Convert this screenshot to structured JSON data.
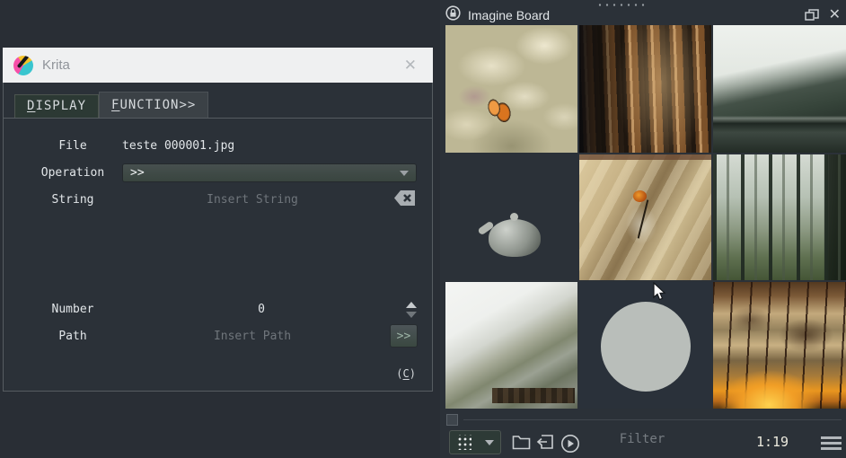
{
  "colors": {
    "window_bg": "#292e35",
    "panel_bg": "#2b3138",
    "titlebar_light": "#eff0f1",
    "accent_green_button": "#3a4841",
    "text_light": "#e2e6e9",
    "text_placeholder": "#6f757b"
  },
  "krita_dialog": {
    "title": "Krita",
    "close_glyph": "✕",
    "tabs": {
      "display": {
        "accel": "D",
        "rest": "ISPLAY"
      },
      "function": {
        "accel": "F",
        "rest": "UNCTION>>"
      }
    },
    "fields": {
      "file": {
        "label": "File",
        "value": "teste 000001.jpg"
      },
      "operation": {
        "label": "Operation",
        "value": ">>"
      },
      "string": {
        "label": "String",
        "placeholder": "Insert String"
      },
      "number": {
        "label": "Number",
        "value": "0"
      },
      "path": {
        "label": "Path",
        "placeholder": "Insert Path",
        "button": ">>"
      }
    },
    "credit": {
      "open": "(",
      "accel": "C",
      "close": ")"
    }
  },
  "imagine_board": {
    "title": "Imagine Board",
    "close_glyph": "✕",
    "images": [
      {
        "name": "butterfly-on-flowers"
      },
      {
        "name": "tree-bark-closeup"
      },
      {
        "name": "misty-mountain-lake"
      },
      {
        "name": "teapot-on-stump"
      },
      {
        "name": "flower-in-glass-vase"
      },
      {
        "name": "foggy-pine-forest"
      },
      {
        "name": "foggy-hillside"
      },
      {
        "name": "loading-placeholder-circle"
      },
      {
        "name": "sunset-lavender-silhouette"
      }
    ],
    "footer": {
      "filter_placeholder": "Filter",
      "counter": "1:19"
    }
  }
}
